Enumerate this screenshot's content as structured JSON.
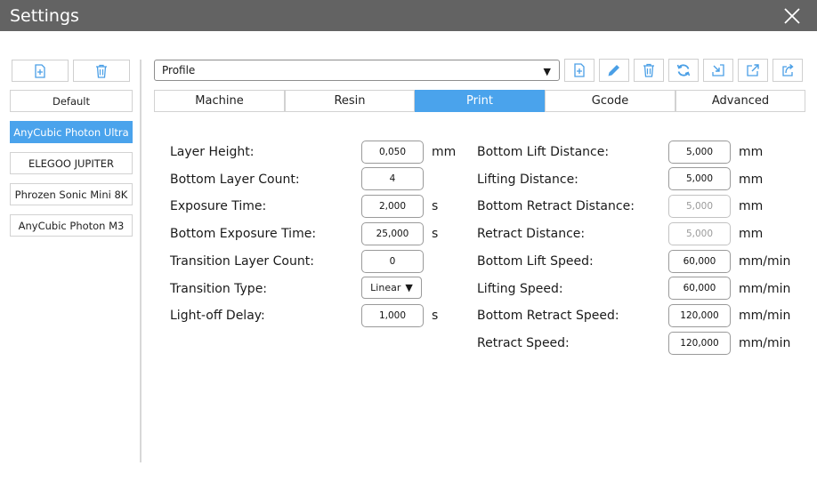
{
  "window": {
    "title": "Settings",
    "close_icon": "close-icon"
  },
  "sidebar": {
    "add_icon": "add-file-icon",
    "delete_icon": "trash-icon",
    "printers": [
      {
        "label": "Default",
        "active": false
      },
      {
        "label": "AnyCubic Photon Ultra",
        "active": true
      },
      {
        "label": "ELEGOO JUPITER",
        "active": false
      },
      {
        "label": "Phrozen Sonic Mini 8K",
        "active": false
      },
      {
        "label": "AnyCubic Photon M3",
        "active": false
      }
    ]
  },
  "toolbar": {
    "profile_value": "Profile",
    "icons": [
      "add-file-icon",
      "pencil-icon",
      "trash-icon",
      "refresh-icon",
      "import-icon",
      "export-icon",
      "export-copy-icon"
    ]
  },
  "tabs": [
    {
      "label": "Machine",
      "active": false
    },
    {
      "label": "Resin",
      "active": false
    },
    {
      "label": "Print",
      "active": true
    },
    {
      "label": "Gcode",
      "active": false
    },
    {
      "label": "Advanced",
      "active": false
    }
  ],
  "print": {
    "left": [
      {
        "label": "Layer Height:",
        "value": "0,050",
        "unit": "mm"
      },
      {
        "label": "Bottom Layer Count:",
        "value": "4",
        "unit": ""
      },
      {
        "label": "Exposure Time:",
        "value": "2,000",
        "unit": "s"
      },
      {
        "label": "Bottom Exposure Time:",
        "value": "25,000",
        "unit": "s"
      },
      {
        "label": "Transition Layer Count:",
        "value": "0",
        "unit": ""
      },
      {
        "label": "Transition Type:",
        "value": "Linear",
        "unit": ""
      },
      {
        "label": "Light-off Delay:",
        "value": "1,000",
        "unit": "s"
      }
    ],
    "right": [
      {
        "label": "Bottom Lift Distance:",
        "value": "5,000",
        "unit": "mm",
        "disabled": false
      },
      {
        "label": "Lifting Distance:",
        "value": "5,000",
        "unit": "mm",
        "disabled": false
      },
      {
        "label": "Bottom Retract Distance:",
        "value": "5,000",
        "unit": "mm",
        "disabled": true
      },
      {
        "label": "Retract Distance:",
        "value": "5,000",
        "unit": "mm",
        "disabled": true
      },
      {
        "label": "Bottom Lift Speed:",
        "value": "60,000",
        "unit": "mm/min",
        "disabled": false
      },
      {
        "label": "Lifting Speed:",
        "value": "60,000",
        "unit": "mm/min",
        "disabled": false
      },
      {
        "label": "Bottom Retract Speed:",
        "value": "120,000",
        "unit": "mm/min",
        "disabled": false
      },
      {
        "label": "Retract Speed:",
        "value": "120,000",
        "unit": "mm/min",
        "disabled": false
      }
    ]
  },
  "colors": {
    "titlebar": "#636363",
    "accent": "#4aa3ec",
    "icon": "#4a9fe6"
  }
}
